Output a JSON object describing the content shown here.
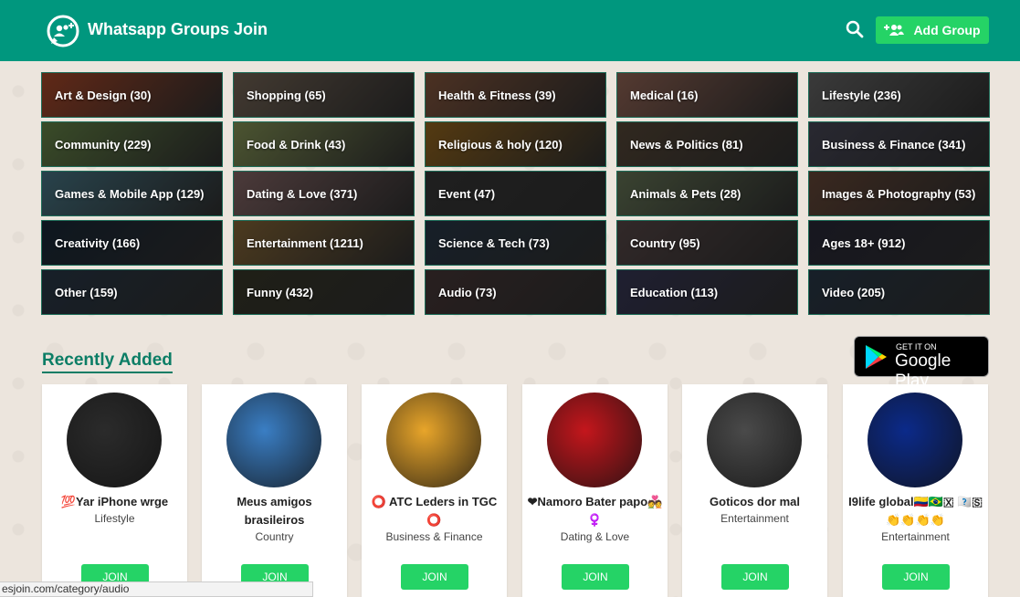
{
  "header": {
    "brand": "Whatsapp Groups Join",
    "add_group_label": "Add Group"
  },
  "categories": [
    {
      "label": "Art & Design (30)",
      "color": "#b04a2a"
    },
    {
      "label": "Shopping (65)",
      "color": "#7a6a5a"
    },
    {
      "label": "Health & Fitness (39)",
      "color": "#8a5a40"
    },
    {
      "label": "Medical (16)",
      "color": "#9a6a5a"
    },
    {
      "label": "Lifestyle (236)",
      "color": "#6a6a6a"
    },
    {
      "label": "Community (229)",
      "color": "#6a8a4a"
    },
    {
      "label": "Food & Drink (43)",
      "color": "#8a9a5a"
    },
    {
      "label": "Religious & holy (120)",
      "color": "#9a6a20"
    },
    {
      "label": "News & Politics (81)",
      "color": "#5a4a3a"
    },
    {
      "label": "Business & Finance (341)",
      "color": "#4a4a5a"
    },
    {
      "label": "Games & Mobile App (129)",
      "color": "#4a7a8a"
    },
    {
      "label": "Dating & Love (371)",
      "color": "#8a6a6a"
    },
    {
      "label": "Event (47)",
      "color": "#3a3a3a"
    },
    {
      "label": "Animals & Pets (28)",
      "color": "#6a7a5a"
    },
    {
      "label": "Images & Photography (53)",
      "color": "#6a4a3a"
    },
    {
      "label": "Creativity (166)",
      "color": "#1a2a3a"
    },
    {
      "label": "Entertainment (1211)",
      "color": "#8a6a3a"
    },
    {
      "label": "Science & Tech (73)",
      "color": "#2a3a4a"
    },
    {
      "label": "Country (95)",
      "color": "#5a4a4a"
    },
    {
      "label": "Ages 18+ (912)",
      "color": "#2a2a3a"
    },
    {
      "label": "Other (159)",
      "color": "#2a3a4a"
    },
    {
      "label": "Funny (432)",
      "color": "#3a3a2a"
    },
    {
      "label": "Audio (73)",
      "color": "#4a3a3a"
    },
    {
      "label": "Education (113)",
      "color": "#3a3a5a"
    },
    {
      "label": "Video (205)",
      "color": "#2a3a4a"
    }
  ],
  "recent": {
    "title": "Recently Added",
    "gplay_small": "GET IT ON",
    "gplay_big": "Google Play"
  },
  "groups": [
    {
      "name": "💯Yar iPhone wrge",
      "category": "Lifestyle",
      "join": "JOIN",
      "avatar_color": "#2b2b2b"
    },
    {
      "name": "Meus amigos brasileiros",
      "category": "Country",
      "join": "JOIN",
      "avatar_color": "#3a7ec4"
    },
    {
      "name": "⭕ ATC Leders in TGC ⭕",
      "category": "Business & Finance",
      "join": "JOIN",
      "avatar_color": "#e8a52a"
    },
    {
      "name": "❤Namoro Bater papo💑♀️",
      "category": "Dating & Love",
      "join": "JOIN",
      "avatar_color": "#c4161c"
    },
    {
      "name": "Goticos dor mal",
      "category": "Entertainment",
      "join": "JOIN",
      "avatar_color": "#4a4a4a"
    },
    {
      "name": "I9life global🇨🇴🇧🇷🇽 🇹🇺🇸👏👏👏👏",
      "category": "Entertainment",
      "join": "JOIN",
      "avatar_color": "#0b2a8a"
    }
  ],
  "status_bar": {
    "url": "esjoin.com/category/audio"
  }
}
